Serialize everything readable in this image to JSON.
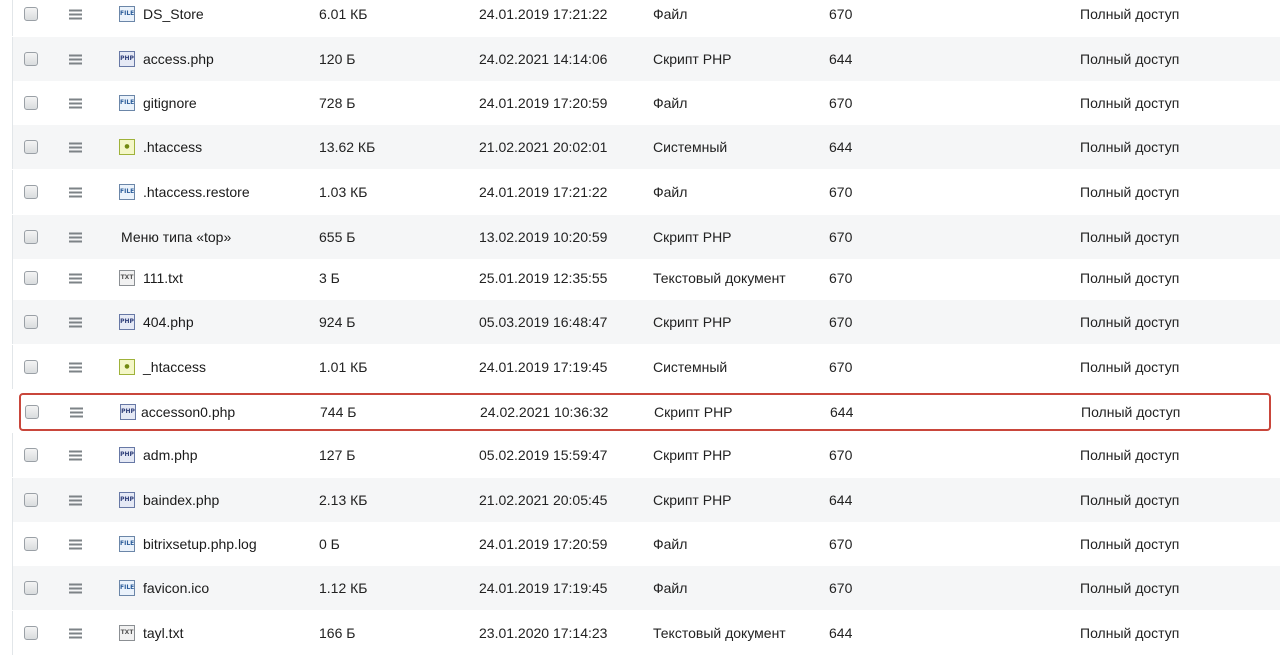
{
  "accent_highlight_color": "#c9463b",
  "files": [
    {
      "name": "DS_Store",
      "size": "6.01 КБ",
      "date": "24.01.2019 17:21:22",
      "type": "Файл",
      "perm": "670",
      "access": "Полный доступ",
      "icon": "file-icon",
      "icon_label": "FILE"
    },
    {
      "name": "access.php",
      "size": "120 Б",
      "date": "24.02.2021 14:14:06",
      "type": "Скрипт PHP",
      "perm": "644",
      "access": "Полный доступ",
      "icon": "php-file-icon",
      "icon_label": "PHP"
    },
    {
      "name": "gitignore",
      "size": "728 Б",
      "date": "24.01.2019 17:20:59",
      "type": "Файл",
      "perm": "670",
      "access": "Полный доступ",
      "icon": "file-icon",
      "icon_label": "FILE"
    },
    {
      "name": ".htaccess",
      "size": "13.62 КБ",
      "date": "21.02.2021 20:02:01",
      "type": "Системный",
      "perm": "644",
      "access": "Полный доступ",
      "icon": "system-file-icon",
      "icon_label": "●"
    },
    {
      "name": ".htaccess.restore",
      "size": "1.03 КБ",
      "date": "24.01.2019 17:21:22",
      "type": "Файл",
      "perm": "670",
      "access": "Полный доступ",
      "icon": "file-icon",
      "icon_label": "FILE"
    },
    {
      "name": "Меню типа «top»",
      "size": "655 Б",
      "date": "13.02.2019 10:20:59",
      "type": "Скрипт PHP",
      "perm": "670",
      "access": "Полный доступ",
      "icon": "",
      "icon_label": ""
    },
    {
      "name": "111.txt",
      "size": "3 Б",
      "date": "25.01.2019 12:35:55",
      "type": "Текстовый документ",
      "perm": "670",
      "access": "Полный доступ",
      "icon": "text-file-icon",
      "icon_label": "TXT"
    },
    {
      "name": "404.php",
      "size": "924 Б",
      "date": "05.03.2019 16:48:47",
      "type": "Скрипт PHP",
      "perm": "670",
      "access": "Полный доступ",
      "icon": "php-file-icon",
      "icon_label": "PHP"
    },
    {
      "name": "_htaccess",
      "size": "1.01 КБ",
      "date": "24.01.2019 17:19:45",
      "type": "Системный",
      "perm": "670",
      "access": "Полный доступ",
      "icon": "system-file-icon",
      "icon_label": "●"
    },
    {
      "name": "accesson0.php",
      "size": "744 Б",
      "date": "24.02.2021 10:36:32",
      "type": "Скрипт PHP",
      "perm": "644",
      "access": "Полный доступ",
      "icon": "php-file-icon",
      "icon_label": "PHP",
      "highlighted": true
    },
    {
      "name": "adm.php",
      "size": "127 Б",
      "date": "05.02.2019 15:59:47",
      "type": "Скрипт PHP",
      "perm": "670",
      "access": "Полный доступ",
      "icon": "php-file-icon",
      "icon_label": "PHP"
    },
    {
      "name": "baindex.php",
      "size": "2.13 КБ",
      "date": "21.02.2021 20:05:45",
      "type": "Скрипт PHP",
      "perm": "644",
      "access": "Полный доступ",
      "icon": "php-file-icon",
      "icon_label": "PHP"
    },
    {
      "name": "bitrixsetup.php.log",
      "size": "0 Б",
      "date": "24.01.2019 17:20:59",
      "type": "Файл",
      "perm": "670",
      "access": "Полный доступ",
      "icon": "file-icon",
      "icon_label": "FILE"
    },
    {
      "name": "favicon.ico",
      "size": "1.12 КБ",
      "date": "24.01.2019 17:19:45",
      "type": "Файл",
      "perm": "670",
      "access": "Полный доступ",
      "icon": "file-icon",
      "icon_label": "FILE"
    },
    {
      "name": "tayl.txt",
      "size": "166 Б",
      "date": "23.01.2020 17:14:23",
      "type": "Текстовый документ",
      "perm": "644",
      "access": "Полный доступ",
      "icon": "text-file-icon",
      "icon_label": "TXT"
    }
  ]
}
